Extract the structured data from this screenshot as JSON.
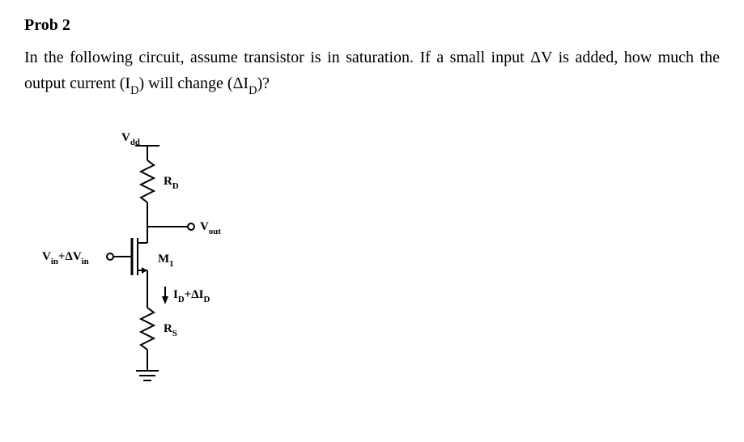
{
  "heading": "Prob 2",
  "prompt": {
    "line1_a": "In the following circuit, assume transistor is in saturation. If a small input ",
    "delta": "Δ",
    "V": "V",
    "line1_b": " is",
    "line2_a": "added, how much the output current (I",
    "D1": "D",
    "line2_b": ") will change (",
    "deltaI": "ΔI",
    "D2": "D",
    "line2_c": ")?"
  },
  "labels": {
    "Vdd_a": "V",
    "Vdd_b": "dd",
    "RD_a": "R",
    "RD_b": "D",
    "Vout_a": "V",
    "Vout_b": "out",
    "Vin_a": "V",
    "Vin_b": "in",
    "Vin_plus": "+",
    "Vin_c": "ΔV",
    "Vin_d": "in",
    "M1_a": "M",
    "M1_b": "1",
    "ID_a": "I",
    "ID_b": "D",
    "ID_plus": "+",
    "ID_c": "ΔI",
    "ID_d": "D",
    "RS_a": "R",
    "RS_b": "S"
  }
}
